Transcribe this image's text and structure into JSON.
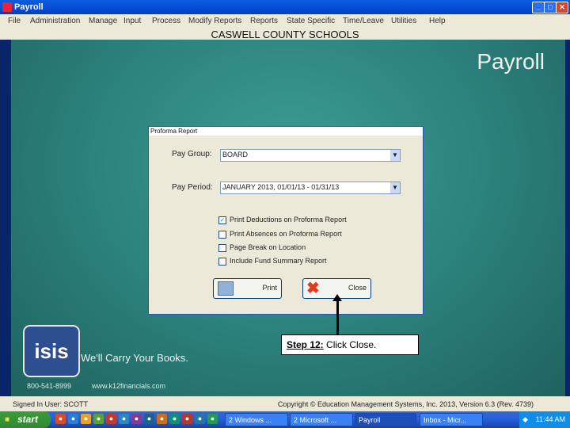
{
  "window": {
    "title": "Payroll",
    "controls": {
      "minimize": "_",
      "maximize": "□",
      "close": "✕"
    }
  },
  "menu": [
    "File",
    "Administration",
    "Manage",
    "Input",
    "Process",
    "Modify Reports",
    "Reports",
    "State Specific",
    "Time/Leave",
    "Utilities",
    "Help"
  ],
  "header": {
    "district": "CASWELL COUNTY SCHOOLS"
  },
  "banner": {
    "app_name": "Payroll"
  },
  "dialog": {
    "title": "Proforma Report",
    "pay_group_label": "Pay Group:",
    "pay_group_value": "BOARD",
    "pay_period_label": "Pay Period:",
    "pay_period_value": "JANUARY 2013, 01/01/13 - 01/31/13",
    "options": [
      {
        "label": "Print Deductions on Proforma Report",
        "checked": true
      },
      {
        "label": "Print Absences on Proforma Report",
        "checked": false
      },
      {
        "label": "Page Break on Location",
        "checked": false
      },
      {
        "label": "Include Fund Summary Report",
        "checked": false
      }
    ],
    "print_label": "Print",
    "close_label": "Close"
  },
  "branding": {
    "logo_text": "isis",
    "tagline": "We'll Carry Your Books.",
    "phone": "800-541-8999",
    "website": "www.k12financials.com"
  },
  "callout": {
    "step_label": "Step 12:",
    "step_text": "Click Close."
  },
  "status": {
    "signed_in": "Signed In User: SCOTT",
    "copyright": "Copyright © Education Management Systems, Inc. 2013, Version 6.3 (Rev. 4739)"
  },
  "taskbar": {
    "start_label": "start",
    "buttons": [
      "2 Windows ...",
      "2 Microsoft ...",
      "Payroll",
      "Inbox - Micr..."
    ],
    "clock": "11:44 AM"
  },
  "colors": {
    "teal_background": "#2b7f7a",
    "taskbar_blue": "#245edb",
    "start_green": "#3c9c3c",
    "dialog_face": "#ece9d8"
  }
}
